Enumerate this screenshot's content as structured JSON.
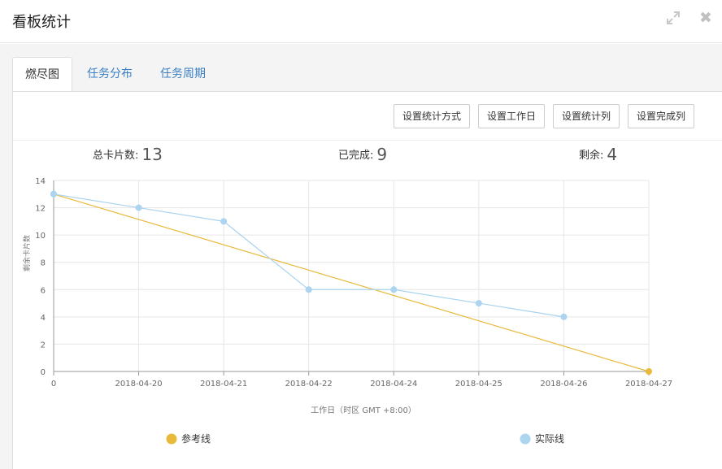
{
  "window": {
    "title": "看板统计",
    "expand_icon": "expand-icon",
    "close_icon": "close-icon",
    "close_glyph": "✖"
  },
  "tabs": [
    {
      "label": "燃尽图",
      "active": true
    },
    {
      "label": "任务分布",
      "active": false
    },
    {
      "label": "任务周期",
      "active": false
    }
  ],
  "toolbar": {
    "buttons": [
      "设置统计方式",
      "设置工作日",
      "设置统计列",
      "设置完成列"
    ]
  },
  "stats": {
    "total_label": "总卡片数:",
    "total_value": "13",
    "done_label": "已完成:",
    "done_value": "9",
    "remaining_label": "剩余:",
    "remaining_value": "4"
  },
  "colors": {
    "reference": "#e8b93b",
    "actual": "#a9d3ef",
    "actual_point": "#aed5f0",
    "grid": "#e6e6e6",
    "axis": "#999999",
    "tab_link": "#3b7fc4"
  },
  "chart_data": {
    "type": "line",
    "categories": [
      "0",
      "2018-04-20",
      "2018-04-21",
      "2018-04-22",
      "2018-04-24",
      "2018-04-25",
      "2018-04-26",
      "2018-04-27"
    ],
    "series": [
      {
        "name": "参考线",
        "values": [
          13,
          null,
          null,
          null,
          null,
          null,
          null,
          0
        ]
      },
      {
        "name": "实际线",
        "values": [
          13,
          12,
          11,
          6,
          6,
          5,
          4,
          null
        ]
      }
    ],
    "xlabel": "工作日（时区 GMT +8:00）",
    "ylabel": "剩余卡片数",
    "ylim": [
      0,
      14
    ],
    "yticks": [
      0,
      2,
      4,
      6,
      8,
      10,
      12,
      14
    ],
    "grid": true,
    "legend_position": "bottom"
  }
}
